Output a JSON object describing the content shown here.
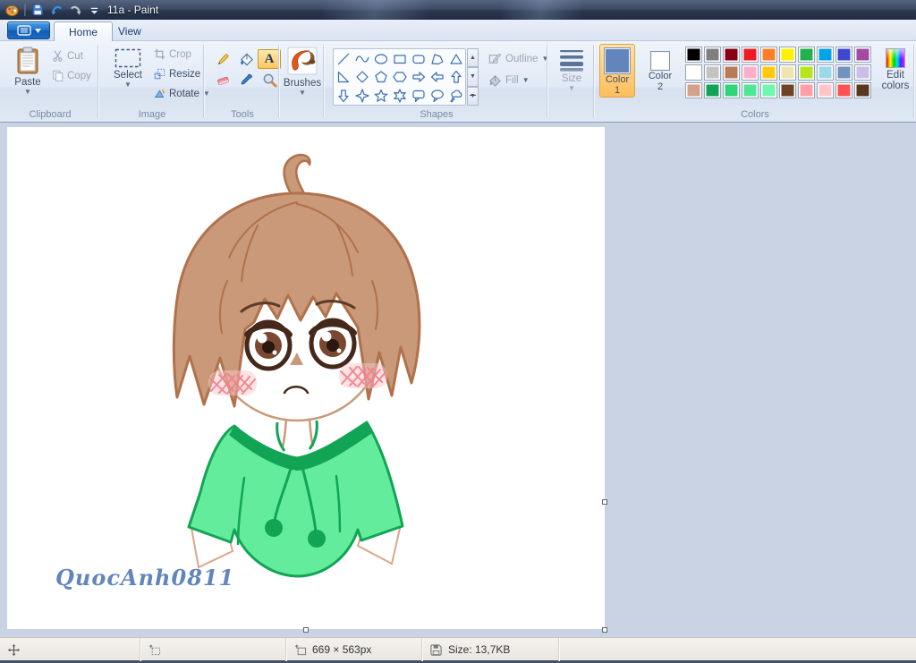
{
  "window": {
    "title": "11a - Paint"
  },
  "tabs": [
    {
      "label": "Home",
      "active": true
    },
    {
      "label": "View",
      "active": false
    }
  ],
  "ribbon": {
    "groups": {
      "clipboard": {
        "label": "Clipboard",
        "paste": "Paste",
        "cut": "Cut",
        "copy": "Copy"
      },
      "image": {
        "label": "Image",
        "select": "Select",
        "crop": "Crop",
        "resize": "Resize",
        "rotate": "Rotate"
      },
      "tools": {
        "label": "Tools",
        "items": [
          "pencil",
          "fill-with-color",
          "text",
          "eraser",
          "color-picker",
          "magnifier"
        ],
        "selected": "text",
        "text_icon_glyph": "A"
      },
      "brushes": {
        "label": "Brushes"
      },
      "shapes": {
        "label": "Shapes",
        "outline": "Outline",
        "fill": "Fill",
        "items": [
          "line",
          "curve",
          "oval",
          "rectangle",
          "rounded-rectangle",
          "polygon",
          "triangle",
          "right-triangle",
          "diamond",
          "pentagon",
          "hexagon",
          "right-arrow",
          "left-arrow",
          "up-arrow",
          "down-arrow",
          "four-point-star",
          "five-point-star",
          "six-point-star",
          "rounded-callout",
          "oval-callout",
          "cloud-callout"
        ]
      },
      "size": {
        "label": "Size"
      },
      "colors": {
        "label": "Colors",
        "color1": {
          "label": "Color 1",
          "value": "#6286BC",
          "selected": true
        },
        "color2": {
          "label": "Color 2",
          "value": "#FFFFFF",
          "selected": false
        },
        "palette": [
          "#000000",
          "#7F7F7F",
          "#880015",
          "#ED1C24",
          "#FF7F27",
          "#FFF200",
          "#22B14C",
          "#00A2E8",
          "#3F48CC",
          "#A349A4",
          "#FFFFFF",
          "#C3C3C3",
          "#B97A57",
          "#FFAEC9",
          "#FFC90E",
          "#EFE4B0",
          "#B5E61D",
          "#99D9EA",
          "#7092BE",
          "#C8BFE7",
          "#D2A186",
          "#12A455",
          "#2ED477",
          "#4FE795",
          "#6FF7AC",
          "#6E4426",
          "#FF9FA5",
          "#FFC6C9",
          "#FF5252",
          "#59361F"
        ],
        "edit": "Edit colors"
      }
    }
  },
  "canvas": {
    "signature": "QuocAnh0811",
    "artwork": {
      "subject": "chibi child with messy brown hair, big brown eyes, blush, green drawstring hoodie",
      "hair_fill": "#C9997A",
      "hair_outline": "#B0714B",
      "hoodie_fill": "#63EC9B",
      "hoodie_outline": "#12A455",
      "blush_color": "#EE7E8C",
      "signature_color": "#6286BC"
    }
  },
  "status_bar": {
    "canvas_size": "669 × 563px",
    "file_size": "Size: 13,7KB"
  }
}
